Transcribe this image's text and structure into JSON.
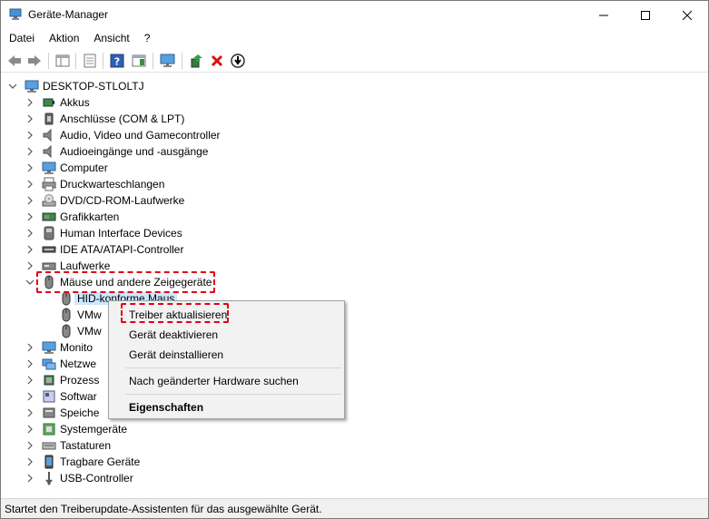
{
  "window": {
    "title": "Geräte-Manager"
  },
  "menu": [
    "Datei",
    "Aktion",
    "Ansicht",
    "?"
  ],
  "toolbar": {
    "buttons": [
      "back-arrow-icon",
      "forward-arrow-icon",
      "show-hide-tree-icon",
      "properties-icon",
      "help-icon",
      "action-pane-icon",
      "monitor-scan-icon",
      "update-driver-icon",
      "uninstall-x-icon",
      "disable-device-icon"
    ]
  },
  "tree": {
    "root": "DESKTOP-STLOLTJ",
    "categories": [
      "Akkus",
      "Anschlüsse (COM & LPT)",
      "Audio, Video und Gamecontroller",
      "Audioeingänge und -ausgänge",
      "Computer",
      "Druckwarteschlangen",
      "DVD/CD-ROM-Laufwerke",
      "Grafikkarten",
      "Human Interface Devices",
      "IDE ATA/ATAPI-Controller",
      "Laufwerke",
      "Mäuse und andere Zeigegeräte"
    ],
    "children": [
      "HID-konforme Maus",
      "VMw",
      "VMw"
    ],
    "categories_after": [
      "Monito",
      "Netzwe",
      "Prozess",
      "Softwar",
      "Speiche",
      "Systemgeräte",
      "Tastaturen",
      "Tragbare Geräte",
      "USB-Controller"
    ]
  },
  "context_menu": {
    "items": [
      "Treiber aktualisieren",
      "Gerät deaktivieren",
      "Gerät deinstallieren",
      "Nach geänderter Hardware suchen",
      "Eigenschaften"
    ]
  },
  "status": "Startet den Treiberupdate-Assistenten für das ausgewählte Gerät.",
  "colors": {
    "highlight": "#e0001a",
    "selection": "#cce8ff",
    "menu_bg": "#f2f2f2"
  }
}
